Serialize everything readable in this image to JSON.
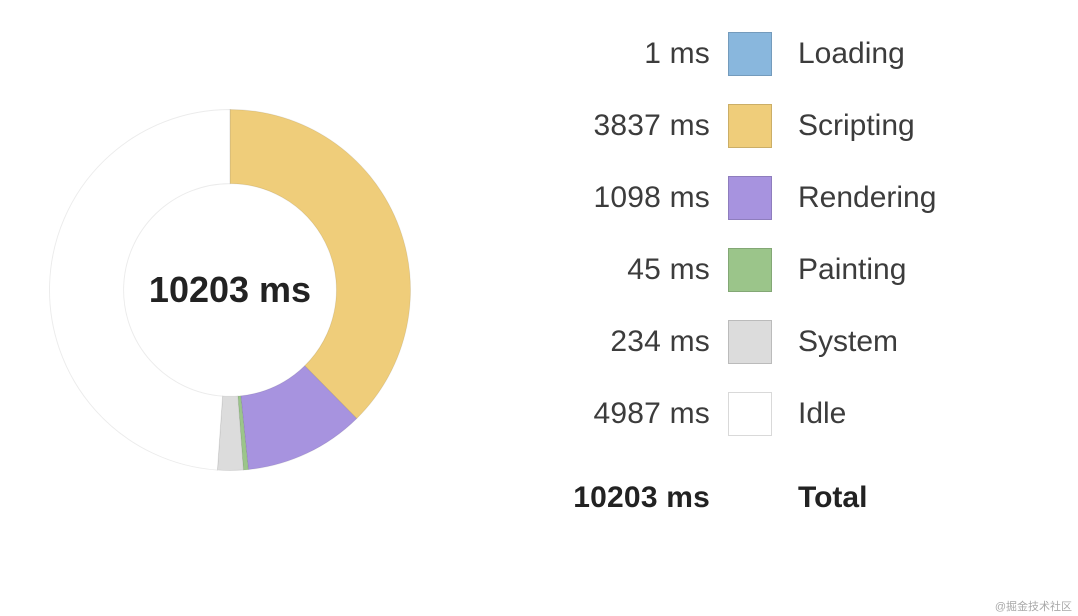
{
  "chart_data": {
    "type": "pie",
    "title": "",
    "unit": "ms",
    "donut": true,
    "total": 10203,
    "total_label": "10203 ms",
    "start_angle_deg": 0,
    "slices": [
      {
        "name": "Loading",
        "value": 1,
        "label": "1 ms",
        "color": "#89b7dd"
      },
      {
        "name": "Scripting",
        "value": 3837,
        "label": "3837 ms",
        "color": "#efcd7a"
      },
      {
        "name": "Rendering",
        "value": 1098,
        "label": "1098 ms",
        "color": "#a793df"
      },
      {
        "name": "Painting",
        "value": 45,
        "label": "45 ms",
        "color": "#9bc58a"
      },
      {
        "name": "System",
        "value": 234,
        "label": "234 ms",
        "color": "#dcdcdc"
      },
      {
        "name": "Idle",
        "value": 4987,
        "label": "4987 ms",
        "color": "#ffffff"
      }
    ],
    "legend_total": {
      "time": "10203 ms",
      "label": "Total"
    }
  },
  "watermark": "@掘金技术社区"
}
